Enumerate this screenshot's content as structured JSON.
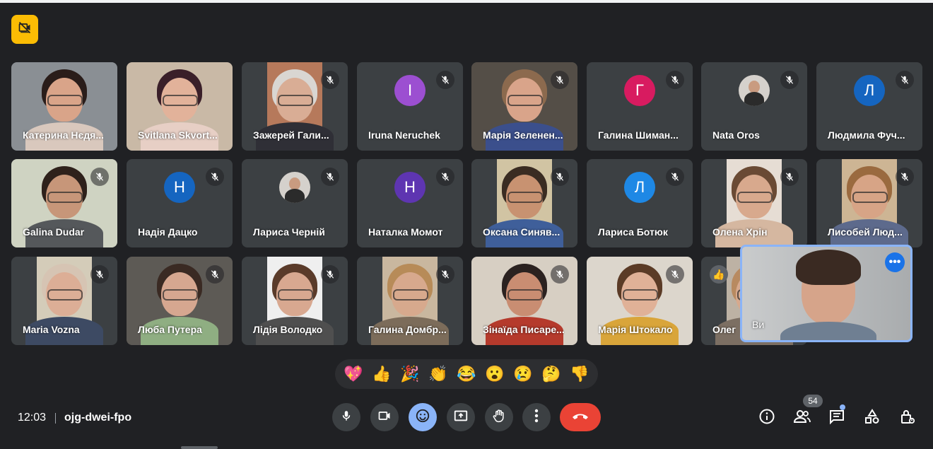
{
  "meeting": {
    "time": "12:03",
    "code": "ojg-dwei-fpo",
    "participant_count": "54"
  },
  "participants": [
    {
      "name": "Катерина Нєдя...",
      "type": "video",
      "muted": false,
      "bg": "#8a8f94",
      "skin": "#d9a489",
      "hair": "#2a1d1a",
      "shirt": "#d9c8bd"
    },
    {
      "name": "Svitlana Skvort...",
      "type": "video",
      "muted": false,
      "bg": "#c9b9a6",
      "skin": "#e2b29a",
      "hair": "#3a1f29",
      "shirt": "#e7cfc5"
    },
    {
      "name": "Зажерей Гали...",
      "type": "video",
      "muted": true,
      "bg": "#b6795b",
      "skin": "#d9ad95",
      "hair": "#d9d6d2",
      "shirt": "#2f2f36"
    },
    {
      "name": "Iruna Neruchek",
      "type": "avatar",
      "muted": true,
      "initial": "I",
      "color": "#9c4fd1"
    },
    {
      "name": "Марія Зеленен...",
      "type": "video",
      "muted": true,
      "bg": "#544e47",
      "skin": "#d9a48a",
      "hair": "#8c6a4e",
      "shirt": "#3b4f8c"
    },
    {
      "name": "Галина Шиман...",
      "type": "avatar",
      "muted": true,
      "initial": "Г",
      "color": "#d81b60"
    },
    {
      "name": "Nata Oros",
      "type": "photo",
      "muted": true
    },
    {
      "name": "Людмила Фуч...",
      "type": "avatar",
      "muted": true,
      "initial": "Л",
      "color": "#1565c0"
    },
    {
      "name": "Galina Dudar",
      "type": "video",
      "muted": true,
      "bg": "#cfd3c2",
      "skin": "#c79679",
      "hair": "#2e211b",
      "shirt": "#55585b"
    },
    {
      "name": "Надія Дацко",
      "type": "avatar",
      "muted": true,
      "initial": "Н",
      "color": "#1565c0"
    },
    {
      "name": "Лариса Черній",
      "type": "photo",
      "muted": true
    },
    {
      "name": "Наталка Момот",
      "type": "avatar",
      "muted": true,
      "initial": "Н",
      "color": "#5e35b1"
    },
    {
      "name": "Оксана Синяв...",
      "type": "video",
      "muted": true,
      "bg": "#d1c4a3",
      "skin": "#c89271",
      "hair": "#3a2c22",
      "shirt": "#3f5f9a"
    },
    {
      "name": "Лариса Ботюк",
      "type": "avatar",
      "muted": true,
      "initial": "Л",
      "color": "#1e88e5"
    },
    {
      "name": "Олена Хрін",
      "type": "video",
      "muted": true,
      "bg": "#e6ddd4",
      "skin": "#d8a98d",
      "hair": "#6a4a34",
      "shirt": "#d5b7a0"
    },
    {
      "name": "Лисобей Люд...",
      "type": "video",
      "muted": true,
      "bg": "#cdb594",
      "skin": "#d7a486",
      "hair": "#9a6a3f",
      "shirt": "#5d6a8c"
    },
    {
      "name": "Maria Vozna",
      "type": "video",
      "muted": true,
      "bg": "#d4ccb9",
      "skin": "#dcae96",
      "hair": "#d6c4b3",
      "shirt": "#3d4a63"
    },
    {
      "name": "Люба Путера",
      "type": "video",
      "muted": true,
      "bg": "#5d5a55",
      "skin": "#d6a790",
      "hair": "#3a2a23",
      "shirt": "#8fae82"
    },
    {
      "name": "Лідія Володко",
      "type": "video",
      "muted": true,
      "bg": "#efefef",
      "skin": "#d8a890",
      "hair": "#5a3b2a",
      "shirt": "#4f4f4f"
    },
    {
      "name": "Галина Домбр...",
      "type": "video",
      "muted": true,
      "bg": "#c9b79f",
      "skin": "#d7a98d",
      "hair": "#b78b58",
      "shirt": "#7c6c5a"
    },
    {
      "name": "Зінаїда Писаре...",
      "type": "video",
      "muted": true,
      "bg": "#d7cfc3",
      "skin": "#c98d72",
      "hair": "#2b2220",
      "shirt": "#b53a2c"
    },
    {
      "name": "Марія Штокало",
      "type": "video",
      "muted": true,
      "bg": "#dcd6cc",
      "skin": "#e0b197",
      "hair": "#5b3b26",
      "shirt": "#d9a53a"
    },
    {
      "name": "Олег",
      "type": "video",
      "muted": false,
      "raised": true,
      "bg": "#bdb2a4",
      "skin": "#d7a98d",
      "hair": "#b88a60",
      "shirt": "#7c6f63"
    }
  ],
  "self_view": {
    "name": "Ви",
    "more_label": "•••"
  },
  "reactions": [
    "💖",
    "👍",
    "🎉",
    "👏",
    "😂",
    "😮",
    "😢",
    "🤔",
    "👎"
  ],
  "controls": {
    "mic": "mic-icon",
    "camera": "camera-icon",
    "emoji": "emoji-icon",
    "present": "present-icon",
    "raise_hand": "hand-icon",
    "more": "more-vert-icon",
    "leave": "call-end-icon"
  },
  "colors": {
    "background": "#202124",
    "tile": "#3c4043",
    "accent": "#8ab4f8",
    "leave": "#ea4335",
    "badge": "#fbbc04"
  }
}
